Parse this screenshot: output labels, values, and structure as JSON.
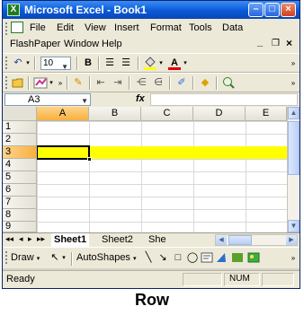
{
  "window": {
    "title": "Microsoft Excel - Book1"
  },
  "menu": {
    "items": [
      "File",
      "Edit",
      "View",
      "Insert",
      "Format",
      "Tools",
      "Data",
      "FlashPaper",
      "Window",
      "Help"
    ],
    "doc_min": "_",
    "doc_restore": "❐",
    "doc_close": "×"
  },
  "toolbar": {
    "font_size": "10",
    "bold": "B"
  },
  "formula_bar": {
    "name_box": "A3",
    "fx_label": "fx"
  },
  "grid": {
    "columns": [
      "A",
      "B",
      "C",
      "D",
      "E"
    ],
    "rows": [
      "1",
      "2",
      "3",
      "4",
      "5",
      "6",
      "7",
      "8",
      "9"
    ],
    "selected_row": "3",
    "active_cell": "A3"
  },
  "sheets": {
    "tabs": [
      "Sheet1",
      "Sheet2",
      "She"
    ],
    "active": "Sheet1"
  },
  "draw_toolbar": {
    "draw_label": "Draw",
    "autoshapes_label": "AutoShapes"
  },
  "status": {
    "ready": "Ready",
    "num": "NUM"
  },
  "caption": "Row",
  "colors": {
    "title_bar": "#0a5ad8",
    "row_highlight": "#ffff00",
    "selected_header": "#f7b13e"
  }
}
